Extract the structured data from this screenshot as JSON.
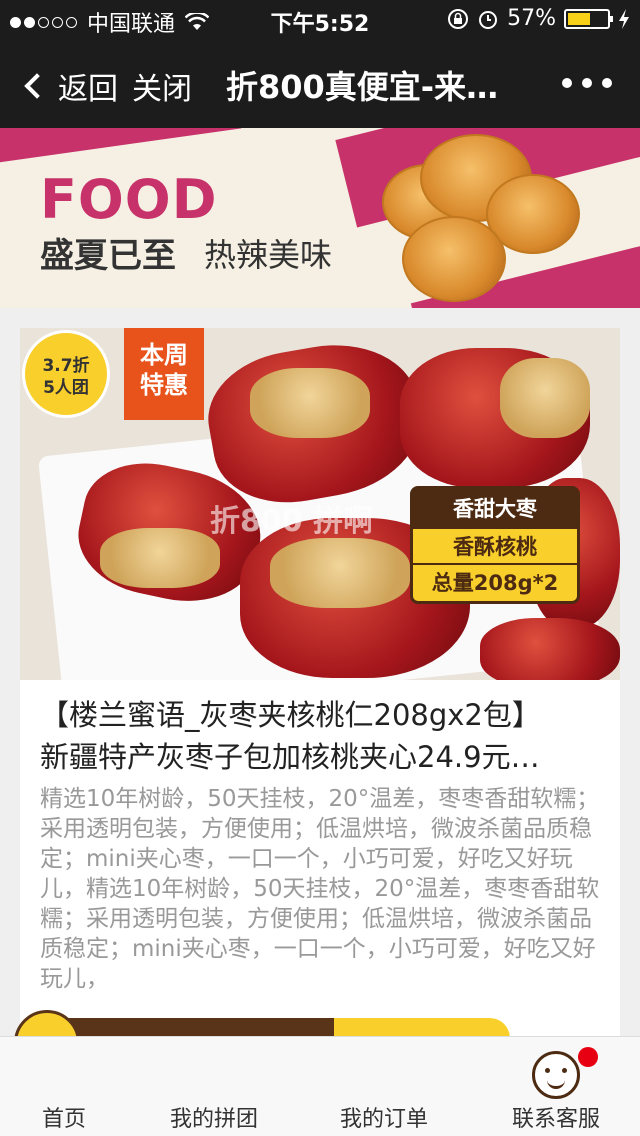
{
  "status_bar": {
    "carrier": "中国联通",
    "time": "下午5:52",
    "battery_percent_label": "57%",
    "battery_level": 0.57
  },
  "nav": {
    "back_label": "返回",
    "close_label": "关闭",
    "title": "折800真便宜-来…"
  },
  "banner": {
    "headline": "FOOD",
    "tagline_bold": "盛夏已至",
    "tagline": "热辣美味"
  },
  "product": {
    "discount_badge_line1": "3.7折",
    "discount_badge_line2": "5人团",
    "weekly_badge": "本周特惠",
    "weekly_badge_line1": "本周",
    "weekly_badge_line2": "特惠",
    "image_labels": [
      "香甜大枣",
      "香酥核桃",
      "总量208g*2"
    ],
    "watermark": "折800 拼啊",
    "title_line1": "【楼兰蜜语_灰枣夹核桃仁208gx2包】",
    "title_line2": "新疆特产灰枣子包加核桃夹心24.9元…",
    "description": "精选10年树龄，50天挂枝，20°温差，枣枣香甜软糯；采用透明包装，方便使用；低温烘培，微波杀菌品质稳定；mini夹心枣，一口一个，小巧可爱，好吃又好玩儿，精选10年树龄，50天挂枝，20°温差，枣枣香甜软糯；采用透明包装，方便使用；低温烘培，微波杀菌品质稳定；mini夹心枣，一口一个，小巧可爱，好吃又好玩儿，"
  },
  "tabs": [
    {
      "label": "首页"
    },
    {
      "label": "我的拼团"
    },
    {
      "label": "我的订单"
    },
    {
      "label": "联系客服"
    }
  ],
  "colors": {
    "nav_bg": "#1c1c1c",
    "brand_pink": "#c7326a",
    "badge_yellow": "#f9cf2b",
    "badge_orange": "#e8531c",
    "label_brown": "#4d2b12",
    "notice_red": "#e60012"
  }
}
